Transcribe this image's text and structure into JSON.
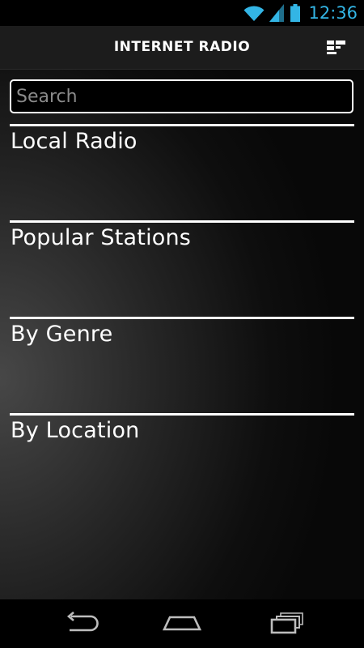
{
  "status_bar": {
    "time": "12:36",
    "accent_color": "#33b5e5",
    "icons": [
      "wifi-icon",
      "signal-icon",
      "battery-icon"
    ]
  },
  "action_bar": {
    "title": "INTERNET RADIO",
    "menu_icon": "list-view-icon"
  },
  "search": {
    "placeholder": "Search",
    "value": ""
  },
  "menu": {
    "items": [
      {
        "label": "Local Radio"
      },
      {
        "label": "Popular Stations"
      },
      {
        "label": "By Genre"
      },
      {
        "label": "By Location"
      }
    ]
  },
  "nav_bar": {
    "icons": [
      "back-icon",
      "home-icon",
      "recent-apps-icon"
    ]
  }
}
